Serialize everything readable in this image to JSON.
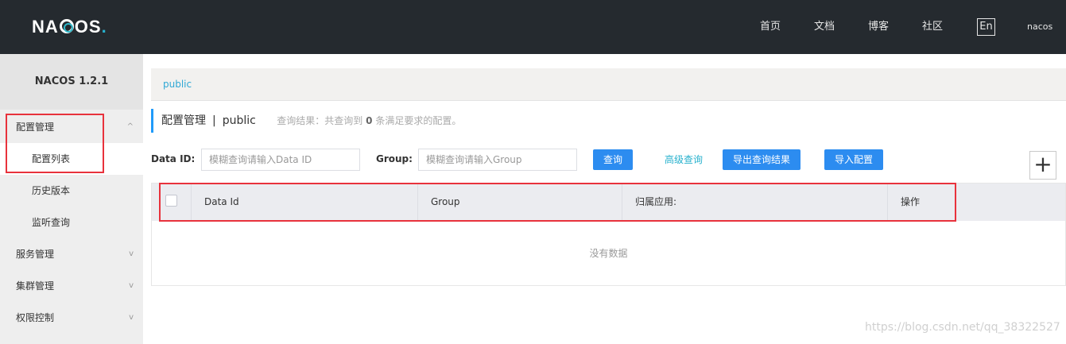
{
  "header": {
    "logo_prefix": "NA",
    "logo_suffix": "OS",
    "logo_dot": ".",
    "nav": [
      "首页",
      "文档",
      "博客",
      "社区"
    ],
    "lang": "En",
    "user": "nacos"
  },
  "sidebar": {
    "title": "NACOS 1.2.1",
    "items": [
      {
        "label": "配置管理"
      },
      {
        "label": "配置列表"
      },
      {
        "label": "历史版本"
      },
      {
        "label": "监听查询"
      },
      {
        "label": "服务管理"
      },
      {
        "label": "集群管理"
      },
      {
        "label": "权限控制"
      }
    ],
    "chevron_up": "^",
    "chevron_down": "v"
  },
  "namespace": {
    "name": "public"
  },
  "page": {
    "title": "配置管理",
    "separator": "|",
    "namespace": "public",
    "query_prefix": "查询结果：共查询到",
    "query_count": "0",
    "query_suffix": "条满足要求的配置。"
  },
  "search": {
    "data_id_label": "Data ID:",
    "data_id_placeholder": "模糊查询请输入Data ID",
    "group_label": "Group:",
    "group_placeholder": "模糊查询请输入Group",
    "query_button": "查询",
    "advanced_query": "高级查询",
    "export_button": "导出查询结果",
    "import_button": "导入配置",
    "add_button": "+"
  },
  "table": {
    "columns": [
      "Data Id",
      "Group",
      "归属应用:",
      "操作"
    ],
    "empty": "没有数据"
  },
  "watermark": "https://blog.csdn.net/qq_38322527",
  "colors": {
    "header_bg": "#252a2f",
    "primary": "#2c8cf0",
    "link": "#27b1cd",
    "highlight": "#e8323c"
  }
}
